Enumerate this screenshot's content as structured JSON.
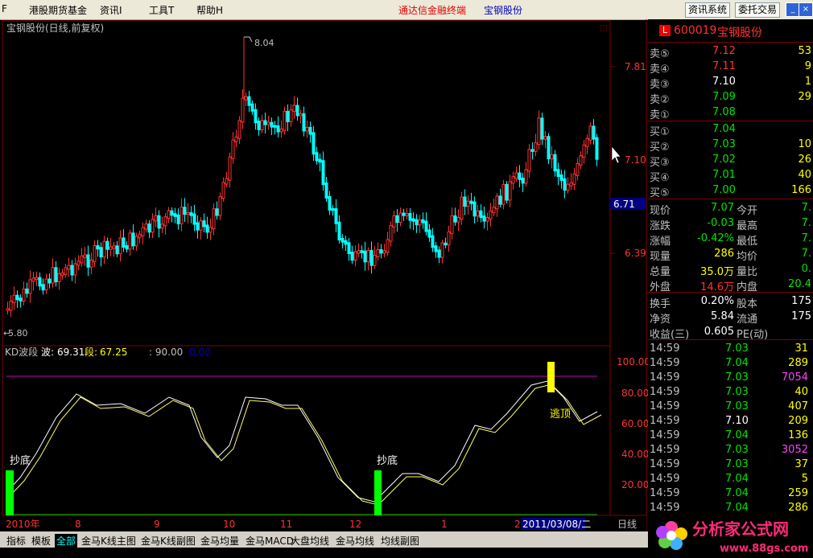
{
  "menu": {
    "cut": "F",
    "items": [
      "港股期货基金",
      "资讯I",
      "工具T",
      "帮助H"
    ],
    "brand": "通达信金融终端",
    "stock": "宝钢股份",
    "btn_news": "资讯系统",
    "btn_trade": "委托交易"
  },
  "chart": {
    "title": "宝钢股份(日线,前复权)",
    "corner": "□",
    "price_ticks": [
      "7.81",
      "7.10",
      "6.39"
    ],
    "current_price_tag": "6.71",
    "high_label": "8.04",
    "low_label": "5.80",
    "indicator": {
      "name": "KD波段",
      "bo_label": "波:",
      "bo_value": "69.31",
      "duan_label": "段:",
      "duan_value": "67.25",
      "extra": ": 90.00",
      "extra2": "0.00",
      "ticks": [
        "100.00",
        "80.00",
        "60.00",
        "40.00",
        "20.00"
      ],
      "annotations": [
        "抄底",
        "抄底",
        "逃顶"
      ]
    },
    "date_axis": [
      "2010年",
      "8",
      "9",
      "10",
      "11",
      "12",
      "1",
      "2"
    ],
    "date_highlight": "2011/03/08/二",
    "period": "日线",
    "colors": {
      "up": "#ff3232",
      "down": "#00ffff",
      "bg": "#000000",
      "grid": "#800000"
    }
  },
  "quote": {
    "code": "600019",
    "name": "宝钢股份",
    "sell": [
      {
        "label": "卖⑤",
        "price": "7.12",
        "vol": "53"
      },
      {
        "label": "卖④",
        "price": "7.11",
        "vol": "9"
      },
      {
        "label": "卖③",
        "price": "7.10",
        "vol": "1"
      },
      {
        "label": "卖②",
        "price": "7.09",
        "vol": "29"
      },
      {
        "label": "卖①",
        "price": "7.08",
        "vol": ""
      }
    ],
    "buy": [
      {
        "label": "买①",
        "price": "7.04",
        "vol": ""
      },
      {
        "label": "买②",
        "price": "7.03",
        "vol": "10"
      },
      {
        "label": "买③",
        "price": "7.02",
        "vol": "26"
      },
      {
        "label": "买④",
        "price": "7.01",
        "vol": "40"
      },
      {
        "label": "买⑤",
        "price": "7.00",
        "vol": "166"
      }
    ],
    "stats": [
      {
        "l1": "现价",
        "v1": "7.07",
        "l2": "今开",
        "v2": "7."
      },
      {
        "l1": "涨跌",
        "v1": "-0.03",
        "l2": "最高",
        "v2": "7."
      },
      {
        "l1": "涨幅",
        "v1": "-0.42%",
        "l2": "最低",
        "v2": "7."
      },
      {
        "l1": "现量",
        "v1": "286",
        "l2": "均价",
        "v2": "7."
      },
      {
        "l1": "总量",
        "v1": "35.0万",
        "l2": "量比",
        "v2": "0."
      },
      {
        "l1": "外盘",
        "v1": "14.6万",
        "l2": "内盘",
        "v2": "20.4"
      }
    ],
    "stats2": [
      {
        "l1": "换手",
        "v1": "0.20%",
        "l2": "股本",
        "v2": "175"
      },
      {
        "l1": "净资",
        "v1": "5.84",
        "l2": "流通",
        "v2": "175"
      },
      {
        "l1": "收益(三)",
        "v1": "0.605",
        "l2": "PE(动)",
        "v2": ""
      }
    ],
    "ticks": [
      {
        "time": "14:59",
        "price": "7.03",
        "vol": "31"
      },
      {
        "time": "14:59",
        "price": "7.04",
        "vol": "289"
      },
      {
        "time": "14:59",
        "price": "7.03",
        "vol": "7054"
      },
      {
        "time": "14:59",
        "price": "7.03",
        "vol": "40"
      },
      {
        "time": "14:59",
        "price": "7.03",
        "vol": "407"
      },
      {
        "time": "14:59",
        "price": "7.10",
        "vol": "209"
      },
      {
        "time": "14:59",
        "price": "7.04",
        "vol": "136"
      },
      {
        "time": "14:59",
        "price": "7.03",
        "vol": "3052"
      },
      {
        "time": "14:59",
        "price": "7.03",
        "vol": "37"
      },
      {
        "time": "14:59",
        "price": "7.04",
        "vol": "5"
      },
      {
        "time": "14:59",
        "price": "7.04",
        "vol": "259"
      },
      {
        "time": "14:59",
        "price": "7.04",
        "vol": "286"
      }
    ]
  },
  "bottom_tabs": [
    "指标",
    "模板",
    "全部",
    "金马K线主图",
    "金马K线副图",
    "金马均量",
    "金马MACD",
    "大盘均线",
    "金马均线",
    "均线副图"
  ],
  "logo": {
    "text": "分析家公式网",
    "url": "www.88gs.com"
  }
}
